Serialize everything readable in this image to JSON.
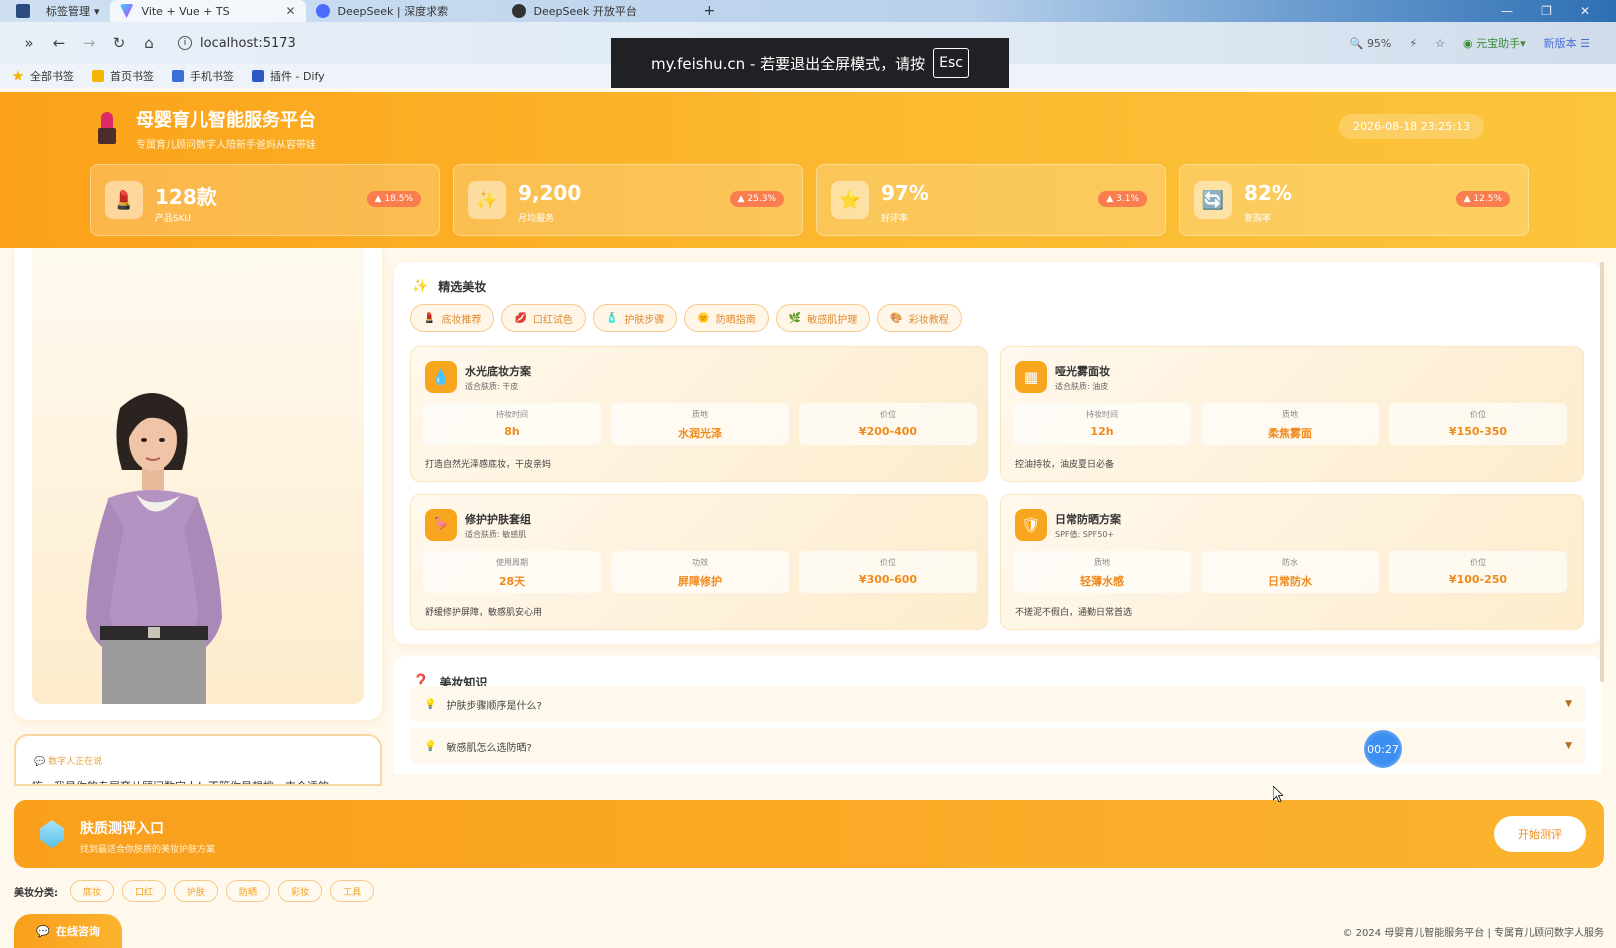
{
  "browser": {
    "tab_group": "标签管理",
    "tabs": [
      {
        "title": "Vite + Vue + TS",
        "active": true
      },
      {
        "title": "DeepSeek | 深度求索",
        "active": false
      },
      {
        "title": "DeepSeek 开放平台",
        "active": false
      }
    ],
    "new_tab": "+",
    "url": "localhost:5173",
    "zoom": "95%",
    "ext_label": "元宝助手",
    "new_version": "新版本",
    "bookmarks": [
      "全部书签",
      "首页书签",
      "手机书签",
      "插件 - Dify"
    ],
    "fullscreen_toast": "my.feishu.cn - 若要退出全屏模式，请按",
    "esc_key": "Esc"
  },
  "header": {
    "title": "母婴育儿智能服务平台",
    "subtitle": "专属育儿顾问数字人陪新手爸妈从容带娃",
    "datetime": "2026-08-18 23:25:13"
  },
  "stats": [
    {
      "value": "128款",
      "label": "产品SKU",
      "trend": "▲ 18.5%",
      "icon": "lipstick-icon"
    },
    {
      "value": "9,200",
      "label": "月均服务",
      "trend": "▲ 25.3%",
      "icon": "sparkle-icon"
    },
    {
      "value": "97%",
      "label": "好评率",
      "trend": "▲ 3.1%",
      "icon": "star-icon"
    },
    {
      "value": "82%",
      "label": "复购率",
      "trend": "▲ 12.5%",
      "icon": "refresh-icon"
    }
  ],
  "chat": {
    "status": "数字人正在说",
    "message": "嗨～我是你的专属育儿顾问数字人！不管你是想挑一支合适的"
  },
  "beauty": {
    "title": "精选美妆",
    "categories": [
      {
        "label": "底妆推荐",
        "icon": "💄"
      },
      {
        "label": "口红试色",
        "icon": "💋"
      },
      {
        "label": "护肤步骤",
        "icon": "🧴"
      },
      {
        "label": "防晒指南",
        "icon": "🌞"
      },
      {
        "label": "敏感肌护理",
        "icon": "🌿"
      },
      {
        "label": "彩妆教程",
        "icon": "🎨"
      }
    ],
    "plans": [
      {
        "name": "水光底妆方案",
        "sub": "适合肤质: 干皮",
        "icon": "💧",
        "metrics": [
          {
            "label": "持妆时间",
            "value": "8h"
          },
          {
            "label": "质地",
            "value": "水润光泽"
          },
          {
            "label": "价位",
            "value": "¥200-400"
          }
        ],
        "desc": "打造自然光泽感底妆，干皮亲妈"
      },
      {
        "name": "哑光雾面妆",
        "sub": "适合肤质: 油皮",
        "icon": "▦",
        "metrics": [
          {
            "label": "持妆时间",
            "value": "12h"
          },
          {
            "label": "质地",
            "value": "柔焦雾面"
          },
          {
            "label": "价位",
            "value": "¥150-350"
          }
        ],
        "desc": "控油持妆，油皮夏日必备"
      },
      {
        "name": "修护护肤套组",
        "sub": "适合肤质: 敏感肌",
        "icon": "🦩",
        "metrics": [
          {
            "label": "使用周期",
            "value": "28天"
          },
          {
            "label": "功效",
            "value": "屏障修护"
          },
          {
            "label": "价位",
            "value": "¥300-600"
          }
        ],
        "desc": "舒缓修护屏障，敏感肌安心用"
      },
      {
        "name": "日常防晒方案",
        "sub": "SPF值: SPF50+",
        "icon": "🛡",
        "metrics": [
          {
            "label": "质地",
            "value": "轻薄水感"
          },
          {
            "label": "防水",
            "value": "日常防水"
          },
          {
            "label": "价位",
            "value": "¥100-250"
          }
        ],
        "desc": "不搓泥不假白，通勤日常首选"
      }
    ]
  },
  "knowledge": {
    "title": "美妆知识",
    "faqs": [
      "护肤步骤顺序是什么?",
      "敏感肌怎么选防晒?"
    ]
  },
  "timer": "00:27",
  "banner": {
    "title": "肤质测评入口",
    "subtitle": "找到最适合你肤质的美妆护肤方案",
    "button": "开始测评"
  },
  "category_bar": {
    "label": "美妆分类:",
    "chips": [
      "底妆",
      "口红",
      "护肤",
      "防晒",
      "彩妆",
      "工具"
    ]
  },
  "consult_button": "在线咨询",
  "footer": "© 2024 母婴育儿智能服务平台 | 专属育儿顾问数字人服务"
}
